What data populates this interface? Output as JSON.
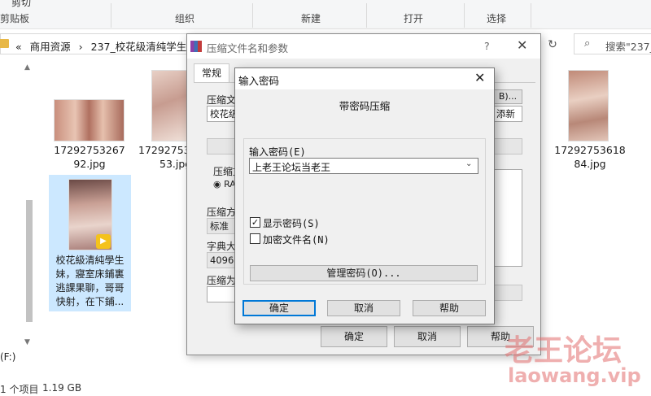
{
  "ribbon": {
    "top_cut_label": "剪切",
    "clipboard": "剪贴板",
    "organize": "组织",
    "new": "新建",
    "open": "打开",
    "select": "选择"
  },
  "address": {
    "crumbs": [
      "«",
      "商用资源",
      "›",
      "237_校花级清纯学生"
    ],
    "search_placeholder": "搜索\"237_"
  },
  "nav": {
    "drive": "(F:)"
  },
  "files": [
    {
      "line1": "17292753267",
      "line2": "92.jpg"
    },
    {
      "line1": "17292753",
      "line2": "53.jpg"
    },
    {
      "line1": "17292753618",
      "line2": "84.jpg"
    },
    {
      "lines": [
        "校花級清純學生",
        "妹，寢室床鋪裏",
        "逃課果聊，哥哥",
        "快射，在下鋪..."
      ],
      "badge": "Player"
    }
  ],
  "status": {
    "count": "1 个项目",
    "size": "1.19 GB"
  },
  "rar": {
    "title": "压缩文件名和参数",
    "help": "?",
    "close": "✕",
    "tab_general": "常规",
    "archive_name_label": "压缩文",
    "archive_name_value": "校花级",
    "browse_cut": "B)...",
    "update_cut": "添新",
    "format_label": "压缩文",
    "format_rar": "RA",
    "method_label": "压缩方",
    "method_value": "标准",
    "dict_label": "字典大",
    "dict_value": "4096 K",
    "volume_label": "压缩为",
    "ok": "确定",
    "cancel": "取消",
    "helpbtn": "帮助"
  },
  "pwd": {
    "title": "输入密码",
    "close": "✕",
    "heading": "带密码压缩",
    "enter_label": "输入密码(E)",
    "password_value": "上老王论坛当老王",
    "show_password": "显示密码(S)",
    "show_checked": true,
    "encrypt_names": "加密文件名(N)",
    "encrypt_checked": false,
    "manage": "管理密码(O)...",
    "ok": "确定",
    "cancel": "取消",
    "help": "帮助"
  },
  "watermark": {
    "line1": "老王论坛",
    "line2": "laowang.vip"
  }
}
